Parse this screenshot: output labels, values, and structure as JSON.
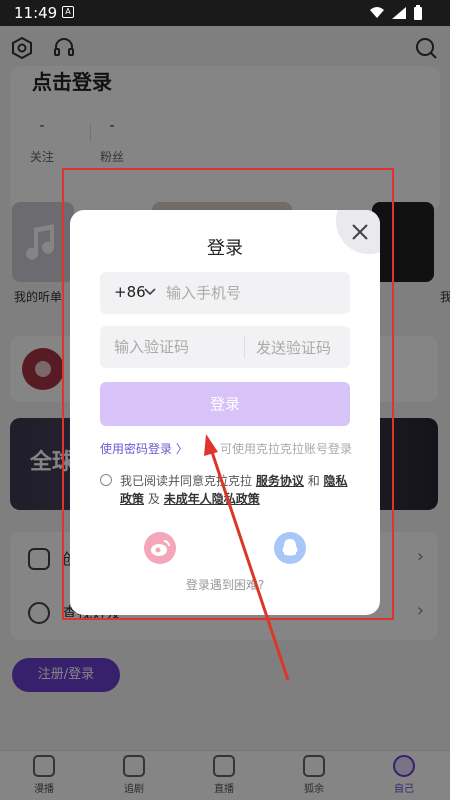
{
  "status_bar": {
    "time": "11:49",
    "a_badge": "A"
  },
  "profile": {
    "login_title": "点击登录",
    "follow_count": "-",
    "follow_label": "关注",
    "fans_count": "-",
    "fans_label": "粉丝"
  },
  "sections": {
    "listen_caption": "我的听单",
    "right_caption": "我",
    "banner_text": "全球"
  },
  "menu": {
    "item1_label": "创",
    "item2_label": "查找好友"
  },
  "register_button": "注册/登录",
  "tabs": [
    {
      "label": "漫播"
    },
    {
      "label": "追剧"
    },
    {
      "label": "直播"
    },
    {
      "label": "狐余"
    },
    {
      "label": "自己"
    }
  ],
  "login_modal": {
    "title": "登录",
    "country_code": "+86",
    "phone_placeholder": "输入手机号",
    "code_placeholder": "输入验证码",
    "send_code": "发送验证码",
    "login_button": "登录",
    "password_login": "使用密码登录 〉",
    "alt_account_note": "可使用克拉克拉账号登录",
    "agreement_prefix": "我已阅读并同意克拉克拉",
    "service_agreement": "服务协议",
    "and1": "和",
    "privacy_policy": "隐私政策",
    "and2": "及",
    "minor_privacy": "未成年人隐私政策",
    "trouble": "登录遇到困难?"
  },
  "colors": {
    "accent": "#6a3fd0",
    "login_button_disabled": "#d7c3f7",
    "annotation_red": "#e0342e",
    "weibo": "#f4a7b9",
    "qq": "#a8c7f8"
  }
}
